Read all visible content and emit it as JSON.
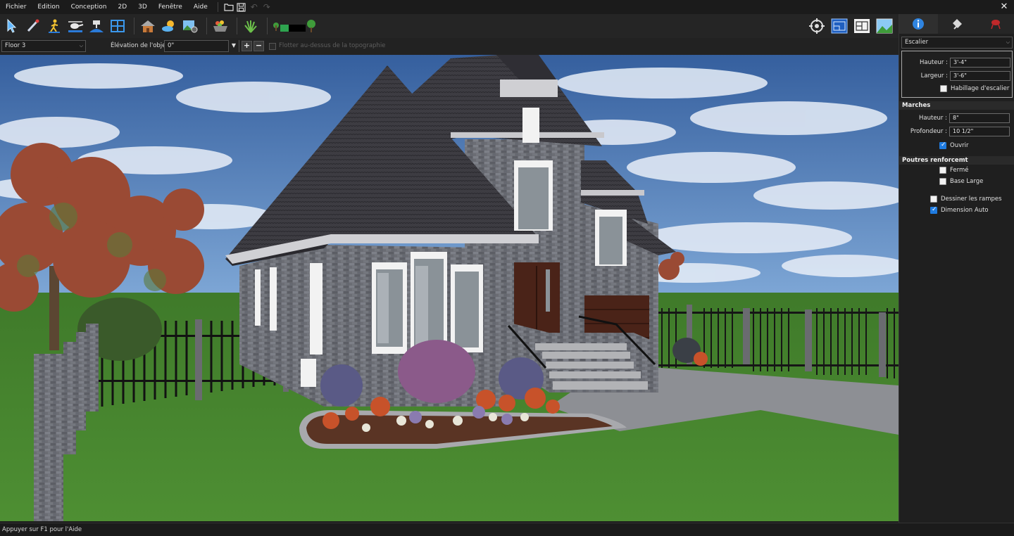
{
  "menu": {
    "items": [
      "Fichier",
      "Edition",
      "Conception",
      "2D",
      "3D",
      "Fenêtre",
      "Aide"
    ]
  },
  "toolbar": {
    "left_icons": [
      "select-arrow-icon",
      "wand-icon",
      "walker-icon",
      "helicopter-icon",
      "camera-crane-icon",
      "plan-view-icon",
      "house-icon",
      "sun-weather-icon",
      "image-settings-icon",
      "landscape-bowl-icon",
      "plants-icon",
      "terrain-slider-icon"
    ],
    "right_icons": [
      "target-icon",
      "blueprint-2d-icon",
      "floorplan-icon",
      "rendered-image-icon"
    ]
  },
  "options": {
    "floor": "Floor 3",
    "elevation_label": "Élévation de l'objet:",
    "elevation_value": "0\"",
    "float_label": "Flotter au-dessus de la topographie"
  },
  "panel": {
    "object_type": "Escalier",
    "hauteur_label": "Hauteur :",
    "hauteur_value": "3'-4\"",
    "largeur_label": "Largeur :",
    "largeur_value": "3'-6\"",
    "habillage_label": "Habillage d'escalier",
    "marches_title": "Marches",
    "m_hauteur_label": "Hauteur :",
    "m_hauteur_value": "8\"",
    "profondeur_label": "Profondeur :",
    "profondeur_value": "10 1/2\"",
    "ouvrir_label": "Ouvrir",
    "poutres_title": "Poutres renforcemt",
    "ferme_label": "Fermé",
    "base_label": "Base Large",
    "rampes_label": "Dessiner les rampes",
    "dim_label": "Dimension Auto"
  },
  "status": {
    "text": "Appuyer sur F1 pour l'Aide"
  }
}
